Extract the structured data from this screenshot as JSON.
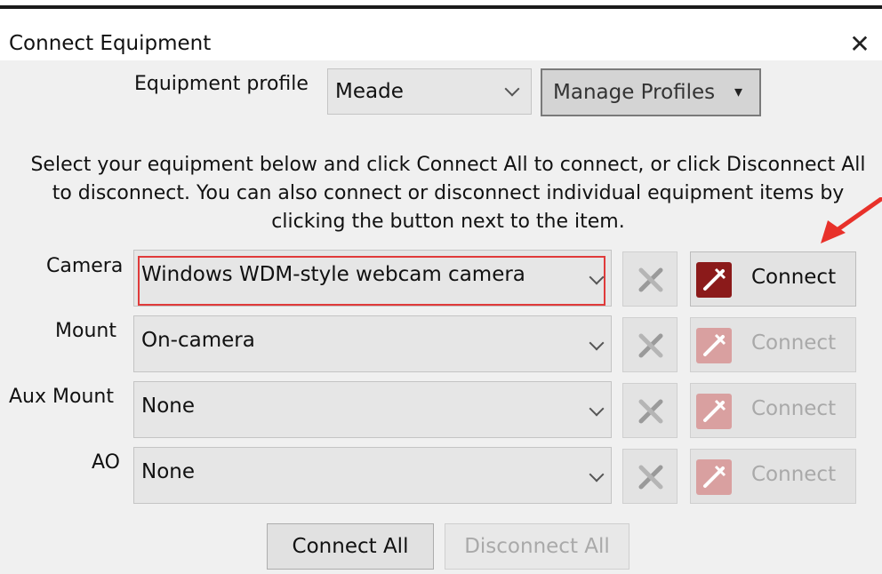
{
  "window": {
    "title": "Connect Equipment",
    "close_glyph": "✕"
  },
  "profile": {
    "label": "Equipment profile",
    "value": "Meade",
    "manage_label": "Manage Profiles",
    "manage_arrow": "▾"
  },
  "instructions": "Select your equipment below and click Connect All to connect, or click Disconnect All to disconnect. You can also connect or disconnect individual equipment items by clicking the button next to the item.",
  "rows": [
    {
      "label": "Camera",
      "value": "Windows WDM-style webcam camera",
      "connect_label": "Connect",
      "enabled": true
    },
    {
      "label": "Mount",
      "value": "On-camera",
      "connect_label": "Connect",
      "enabled": false
    },
    {
      "label": "Aux Mount",
      "value": "None",
      "connect_label": "Connect",
      "enabled": false
    },
    {
      "label": "AO",
      "value": "None",
      "connect_label": "Connect",
      "enabled": false
    }
  ],
  "footer": {
    "connect_all": "Connect All",
    "disconnect_all": "Disconnect All"
  },
  "icons": {
    "close": "close-icon",
    "dropdown": "chevron-down-icon",
    "settings": "wrench-screwdriver-icon",
    "connect": "plug-icon",
    "annotation": "red-arrow"
  },
  "colors": {
    "highlight_border": "#e03a3a",
    "plug_active": "#8b1a1a",
    "plug_disabled": "#d9a0a0",
    "annotation_arrow": "#e8312a"
  }
}
